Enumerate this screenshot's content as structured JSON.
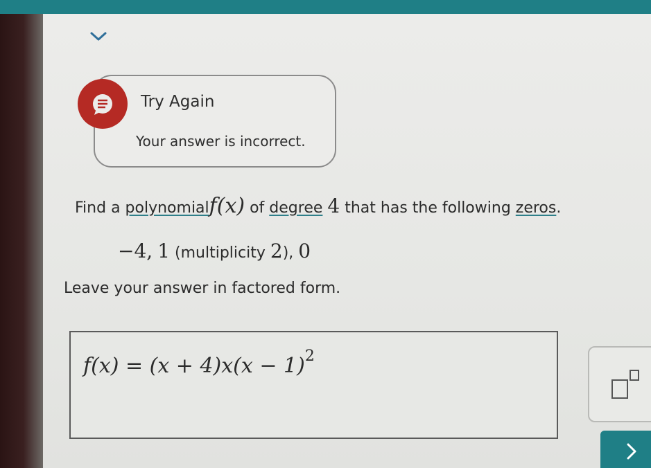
{
  "colors": {
    "accent": "#1f7f86",
    "error_icon": "#b52a24"
  },
  "header": {
    "collapse_icon": "chevron-down-icon"
  },
  "feedback": {
    "icon": "feedback-icon",
    "title": "Try Again",
    "message": "Your answer is incorrect."
  },
  "question": {
    "part1": "Find a ",
    "link_polynomial": "polynomial",
    "fx": "f(x)",
    "part2": " of ",
    "link_degree": "degree",
    "degree_value": "4",
    "part3": " that has the following ",
    "link_zeros": "zeros",
    "part4": ".",
    "zero1": "−4,",
    "zero2": "1",
    "multiplicity_label": "(multiplicity ",
    "multiplicity_value": "2",
    "multiplicity_close": "),",
    "zero3": "0",
    "instruction": "Leave your answer in factored form."
  },
  "answer": {
    "lhs": "f(x) = ",
    "rhs": "(x + 4)x(x − 1)",
    "exponent": "2"
  },
  "tools": {
    "exponent_icon": "exponent-template-icon"
  },
  "navigation": {
    "next_icon": "chevron-right-icon"
  }
}
